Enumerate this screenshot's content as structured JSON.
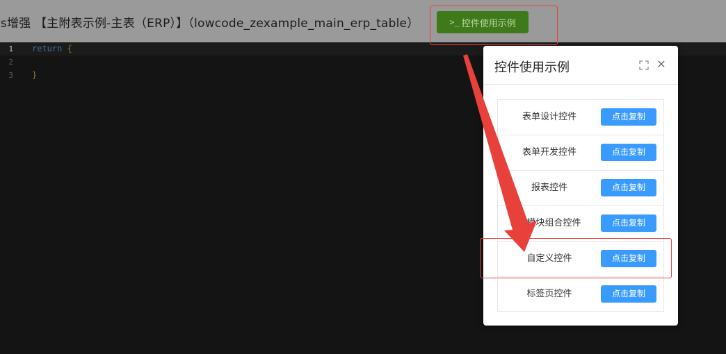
{
  "header": {
    "title": "js增强 【主附表示例-主表（ERP）】（lowcode_zexample_main_erp_table）",
    "example_button": {
      "icon": "terminal-icon",
      "label": "控件使用示例"
    }
  },
  "editor": {
    "lines": [
      {
        "number": "1",
        "keyword": "return",
        "text": " {"
      },
      {
        "number": "2",
        "keyword": "",
        "text": ""
      },
      {
        "number": "3",
        "keyword": "",
        "text": "}"
      }
    ]
  },
  "modal": {
    "title": "控件使用示例",
    "fullscreen_icon": "fullscreen-icon",
    "close_icon": "close-icon",
    "items": [
      {
        "label": "表单设计控件",
        "button": "点击复制"
      },
      {
        "label": "表单开发控件",
        "button": "点击复制"
      },
      {
        "label": "报表控件",
        "button": "点击复制"
      },
      {
        "label": "多模块组合控件",
        "button": "点击复制"
      },
      {
        "label": "自定义控件",
        "button": "点击复制"
      },
      {
        "label": "标签页控件",
        "button": "点击复制"
      }
    ]
  },
  "colors": {
    "example_button_bg": "#3f7a1a",
    "copy_button_bg": "#3a9bff",
    "annotation": "#e8403a"
  }
}
